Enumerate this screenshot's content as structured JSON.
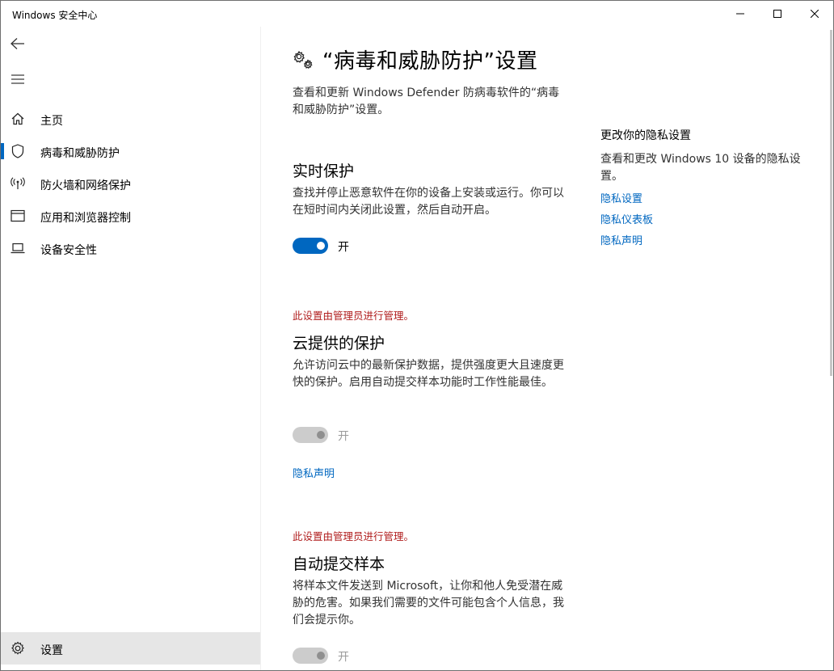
{
  "window": {
    "title": "Windows 安全中心"
  },
  "nav": {
    "items": [
      {
        "label": "主页",
        "icon": "home-icon"
      },
      {
        "label": "病毒和威胁防护",
        "icon": "shield-icon",
        "selected": true
      },
      {
        "label": "防火墙和网络保护",
        "icon": "antenna-icon"
      },
      {
        "label": "应用和浏览器控制",
        "icon": "app-window-icon"
      },
      {
        "label": "设备安全性",
        "icon": "laptop-icon"
      }
    ],
    "settings_label": "设置"
  },
  "page": {
    "title": "“病毒和威胁防护”设置",
    "description": "查看和更新 Windows Defender 防病毒软件的“病毒和威胁防护”设置。"
  },
  "sections": {
    "realtime": {
      "title": "实时保护",
      "description": "查找并停止恶意软件在你的设备上安装或运行。你可以在短时间内关闭此设置，然后自动开启。",
      "toggle_label": "开",
      "toggle_state": "on"
    },
    "cloud": {
      "managed_notice": "此设置由管理员进行管理。",
      "title": "云提供的保护",
      "description": "允许访问云中的最新保护数据，提供强度更大且速度更快的保护。启用自动提交样本功能时工作性能最佳。",
      "toggle_label": "开",
      "toggle_state": "disabled-on",
      "privacy_link": "隐私声明"
    },
    "sample": {
      "managed_notice": "此设置由管理员进行管理。",
      "title": "自动提交样本",
      "description": "将样本文件发送到 Microsoft，让你和他人免受潜在威胁的危害。如果我们需要的文件可能包含个人信息，我们会提示你。",
      "toggle_label": "开",
      "toggle_state": "disabled-on"
    }
  },
  "privacy_panel": {
    "title": "更改你的隐私设置",
    "description": "查看和更改 Windows 10 设备的隐私设置。",
    "links": [
      "隐私设置",
      "隐私仪表板",
      "隐私声明"
    ]
  },
  "colors": {
    "accent": "#0067c0",
    "managed_text": "#b01d1d",
    "disabled_toggle": "#cccccc"
  }
}
